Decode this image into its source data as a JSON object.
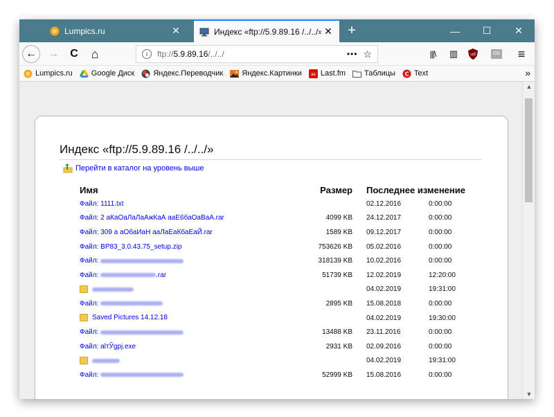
{
  "tabs": [
    {
      "title": "Lumpics.ru",
      "close": "✕"
    },
    {
      "title": "Индекс «ftp://5.9.89.16 /../../»",
      "close": "✕"
    }
  ],
  "new_tab": "+",
  "window_buttons": {
    "minimize": "—",
    "maximize": "☐",
    "close": "✕"
  },
  "nav": {
    "back": "←",
    "forward": "→",
    "reload": "C",
    "home": "⌂"
  },
  "url": {
    "scheme": "ftp://",
    "host": "5.9.89.16",
    "path": " /../../",
    "dots": "•••",
    "star": "☆"
  },
  "toolbar_right": {
    "library": "|||\\",
    "sidebar": "▥",
    "ublock": "ud",
    "os": "OS",
    "menu": "≡"
  },
  "bookmarks": [
    {
      "label": "Lumpics.ru",
      "icon": "orange-circle-icon"
    },
    {
      "label": "Google Диск",
      "icon": "google-drive-icon"
    },
    {
      "label": "Яндекс.Переводчик",
      "icon": "translator-icon"
    },
    {
      "label": "Яндекс.Картинки",
      "icon": "images-icon"
    },
    {
      "label": "Last.fm",
      "icon": "lastfm-icon"
    },
    {
      "label": "Таблицы",
      "icon": "folder-icon"
    },
    {
      "label": "Text",
      "icon": "copyright-icon"
    }
  ],
  "bookmarks_more": "»",
  "page": {
    "heading": "Индекс «ftp://5.9.89.16 /../../»",
    "up_link": "Перейти в каталог на уровень выше",
    "columns": {
      "name": "Имя",
      "size": "Размер",
      "modified": "Последнее изменение"
    },
    "file_prefix": "Файл:",
    "rows": [
      {
        "type": "file",
        "name": "1111.txt",
        "size": "",
        "date": "02.12.2016",
        "time": "0:00:00"
      },
      {
        "type": "file",
        "name": "2 аКаОаЛаЛаАжКаА ааЕ6баОаВаА.rar",
        "size": "4099 KB",
        "date": "24.12.2017",
        "time": "0:00:00"
      },
      {
        "type": "file",
        "name": "309 а аОбаИаН ааЛаЕаКбаЕаЙ.rar",
        "size": "1589 KB",
        "date": "09.12.2017",
        "time": "0:00:00"
      },
      {
        "type": "file",
        "name": "BP83_3.0.43.75_setup.zip",
        "size": "753626 KB",
        "date": "05.02.2016",
        "time": "0:00:00"
      },
      {
        "type": "file",
        "name": "",
        "size": "318139 KB",
        "date": "10.02.2016",
        "time": "0:00:00"
      },
      {
        "type": "file",
        "name": ".rar",
        "size": "51739 KB",
        "date": "12.02.2019",
        "time": "12:20:00"
      },
      {
        "type": "folder",
        "name": "",
        "size": "",
        "date": "04.02.2019",
        "time": "19:31:00"
      },
      {
        "type": "file",
        "name": "",
        "size": "2895 KB",
        "date": "15.08.2018",
        "time": "0:00:00"
      },
      {
        "type": "folder",
        "name": "Saved Pictures 14.12.18",
        "size": "",
        "date": "04.02.2019",
        "time": "19:30:00"
      },
      {
        "type": "file",
        "name": "",
        "size": "13488 KB",
        "date": "23.11.2016",
        "time": "0:00:00"
      },
      {
        "type": "file",
        "name": "alтЎgpj.exe",
        "size": "2931 KB",
        "date": "02.09.2016",
        "time": "0:00:00"
      },
      {
        "type": "folder",
        "name": "",
        "size": "",
        "date": "04.02.2019",
        "time": "19:31:00"
      },
      {
        "type": "file",
        "name": "",
        "size": "52999 KB",
        "date": "15.08.2016",
        "time": "0:00:00"
      }
    ]
  },
  "colors": {
    "tabbar": "#4a7b8a",
    "link": "#0000ee",
    "accent": "#0a84ff"
  }
}
